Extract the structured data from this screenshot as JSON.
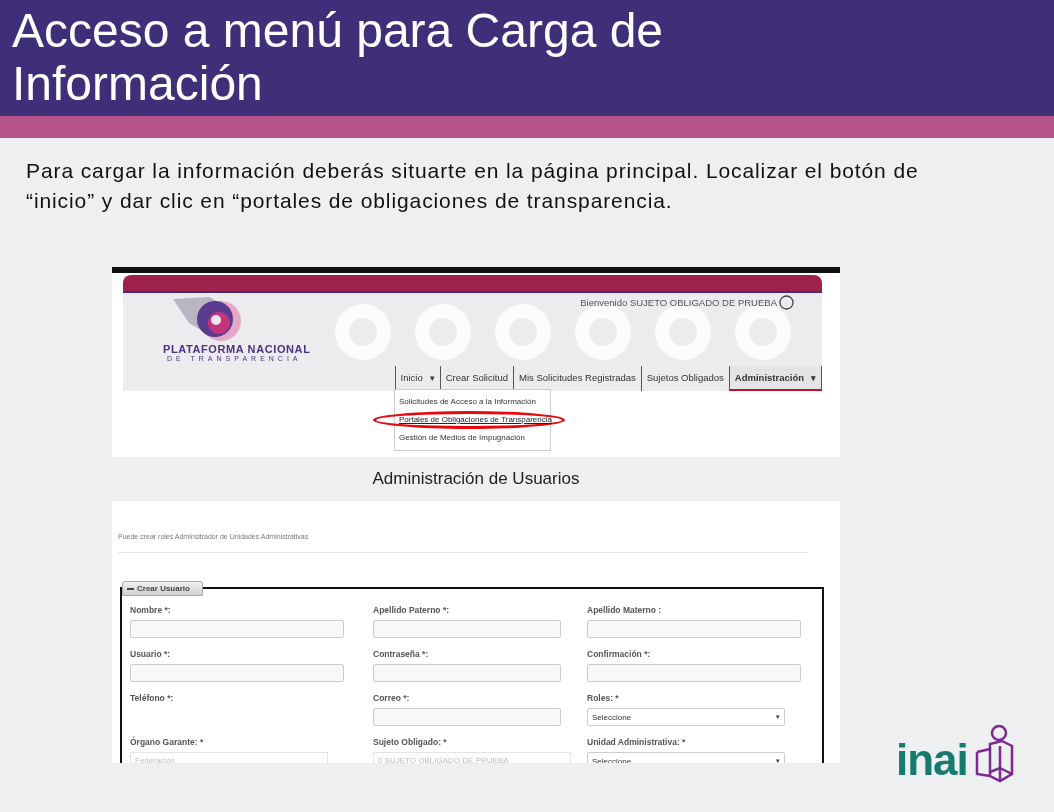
{
  "slide": {
    "title": "Acceso a menú para Carga de Información",
    "body": "Para cargar la información deberás situarte en la página principal. Localizar el botón de “inicio” y dar clic en “portales de obligaciones de transparencia."
  },
  "screenshot": {
    "welcome": "Bienvenido SUJETO OBLIGADO DE PRUEBA",
    "logo": {
      "line_1": "PLATAFORMA NACIONAL",
      "line_2": "DE TRANSPARENCIA"
    },
    "nav": [
      {
        "label": "Inicio",
        "caret": "▾",
        "selected": false
      },
      {
        "label": "Crear Solicitud",
        "selected": false
      },
      {
        "label": "Mis Solicitudes Registradas",
        "selected": false
      },
      {
        "label": "Sujetos Obligados",
        "selected": false
      },
      {
        "label": "Administración",
        "caret": "▾",
        "selected": true
      }
    ],
    "menu": [
      {
        "label": "Solicitudes de Acceso a la Información",
        "highlighted": false
      },
      {
        "label": "Portales de Obligaciones de Transparencia",
        "highlighted": true
      },
      {
        "label": "Gestión de Medios de Impugnación",
        "highlighted": false
      }
    ],
    "page_title": "Administración de Usuarios",
    "note": "Puede crear roles Adminsitrador de Unidades Administrativas",
    "panel": {
      "title": "Crear Usuario",
      "expanded": true,
      "fields": [
        {
          "label": "Nombre *:",
          "kind": "input"
        },
        {
          "label": "Apellido Paterno *:",
          "kind": "input"
        },
        {
          "label": "Apellido Materno :",
          "kind": "input"
        },
        {
          "label": "Usuario *:",
          "kind": "input"
        },
        {
          "label": "Contraseña *:",
          "kind": "input"
        },
        {
          "label": "Confirmación *:",
          "kind": "input"
        },
        {
          "label": "Teléfono *:",
          "kind": "none"
        },
        {
          "label": "Correo *:",
          "kind": "input"
        },
        {
          "label": "Roles: *",
          "kind": "select",
          "value": "Seleccione",
          "caret": "▾"
        },
        {
          "label": "Órgano Garante: *",
          "kind": "readonly",
          "placeholder": "Federación"
        },
        {
          "label": "Sujeto Obligado: *",
          "kind": "readonly",
          "placeholder": "0 SUJETO OBLIGADO DE PRUEBA"
        },
        {
          "label": "Unidad Administrativa: *",
          "kind": "select",
          "value": "Seleccione",
          "caret": "▾"
        }
      ]
    }
  },
  "brand": "inai"
}
